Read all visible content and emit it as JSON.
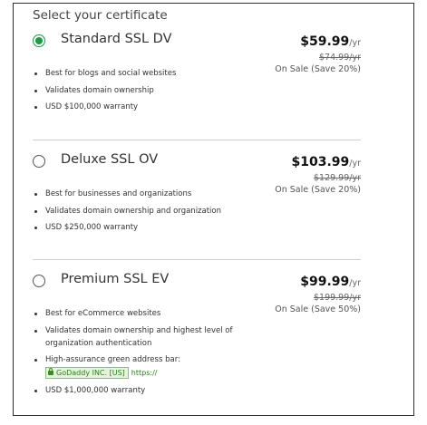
{
  "heading": "Select your certificate",
  "options": [
    {
      "name": "Standard SSL DV",
      "selected": true,
      "price": "$59.99",
      "per": "/yr",
      "old_price": "$74.99/yr",
      "sale": "On Sale (Save 20%)",
      "features": [
        "Best for blogs and social websites",
        "Validates domain ownership",
        "USD $100,000 warranty"
      ]
    },
    {
      "name": "Deluxe SSL OV",
      "selected": false,
      "price": "$103.99",
      "per": "/yr",
      "old_price": "$129.99/yr",
      "sale": "On Sale (Save 20%)",
      "features": [
        "Best for businesses and organizations",
        "Validates domain ownership and organization",
        "USD $250,000 warranty"
      ]
    },
    {
      "name": "Premium SSL EV",
      "selected": false,
      "price": "$99.99",
      "per": "/yr",
      "old_price": "$199.99/yr",
      "sale": "On Sale (Save 50%)",
      "features": [
        "Best for eCommerce websites",
        "Validates domain ownership and highest level of organization authentication",
        "High-assurance green address bar:",
        "USD $1,000,000 warranty"
      ],
      "address_bar": {
        "company": "GoDaddy INC. [US]",
        "protocol": "https://"
      }
    }
  ],
  "colors": {
    "selected_radio": "#1c9b45",
    "green_bar_background": "#e6f4dd",
    "green_bar_text": "#2a7d1a"
  }
}
